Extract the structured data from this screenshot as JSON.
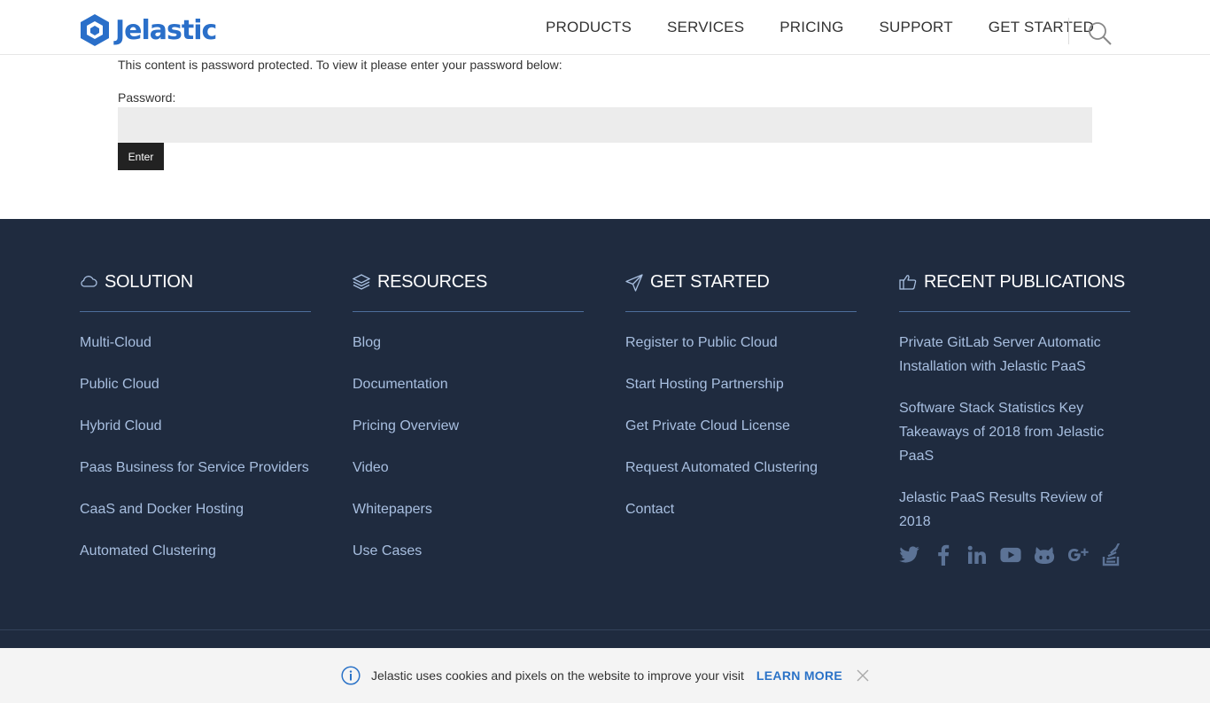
{
  "header": {
    "logo_text": "Jelastic",
    "nav": [
      "PRODUCTS",
      "SERVICES",
      "PRICING",
      "SUPPORT",
      "GET STARTED"
    ]
  },
  "main": {
    "intro": "This content is password protected. To view it please enter your password below:",
    "password_label": "Password:",
    "password_value": "",
    "enter_label": "Enter"
  },
  "footer": {
    "columns": [
      {
        "title": "SOLUTION",
        "icon": "cloud-icon",
        "links": [
          "Multi-Cloud",
          "Public Cloud",
          "Hybrid Cloud",
          "Paas Business for Service Providers",
          "CaaS and Docker Hosting",
          "Automated Clustering"
        ]
      },
      {
        "title": "RESOURCES",
        "icon": "layers-icon",
        "links": [
          "Blog",
          "Documentation",
          "Pricing Overview",
          "Video",
          "Whitepapers",
          "Use Cases"
        ]
      },
      {
        "title": "GET STARTED",
        "icon": "paper-plane-icon",
        "links": [
          "Register to Public Cloud",
          "Start Hosting Partnership",
          "Get Private Cloud License",
          "Request Automated Clustering",
          "Contact"
        ]
      },
      {
        "title": "RECENT PUBLICATIONS",
        "icon": "thumbs-up-icon",
        "links": [
          "Private GitLab Server Automatic Installation with Jelastic PaaS",
          "Software Stack Statistics Key Takeaways of 2018 from Jelastic PaaS",
          "Jelastic PaaS Results Review of 2018"
        ]
      }
    ],
    "social_icons": [
      "twitter-icon",
      "facebook-icon",
      "linkedin-icon",
      "youtube-icon",
      "github-icon",
      "google-plus-icon",
      "stackoverflow-icon"
    ]
  },
  "cookie": {
    "text": "Jelastic uses cookies and pixels on the website to improve your visit",
    "learn_more": "LEARN MORE"
  },
  "colors": {
    "brand": "#2a6fc9",
    "footer_bg": "#1f2b3f",
    "footer_link": "#a8bfe0",
    "accent_link": "#2a72c7"
  }
}
